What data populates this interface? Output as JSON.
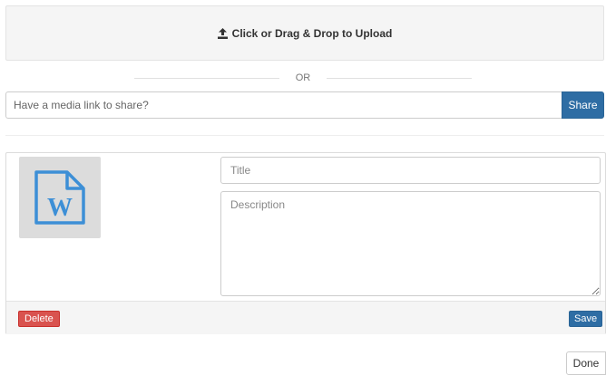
{
  "upload": {
    "label": "Click or Drag & Drop to Upload",
    "icon": "upload-icon"
  },
  "separator": {
    "text": "OR"
  },
  "media_link": {
    "placeholder": "Have a media link to share?",
    "value": "",
    "share_label": "Share"
  },
  "media_item": {
    "file_icon": "word-document-icon",
    "title_placeholder": "Title",
    "title_value": "",
    "description_placeholder": "Description",
    "description_value": "",
    "delete_label": "Delete",
    "save_label": "Save"
  },
  "done_label": "Done",
  "colors": {
    "primary": "#2e6da4",
    "danger": "#d9534f",
    "word_blue": "#3d8fd6",
    "panel_bg": "#f5f5f5"
  }
}
